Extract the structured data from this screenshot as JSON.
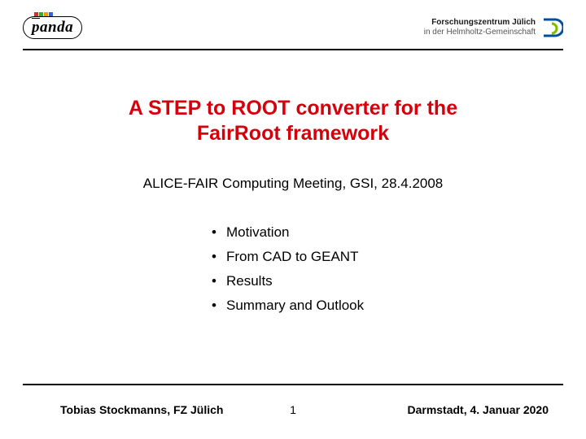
{
  "header": {
    "panda_label": "panda",
    "julich_line1": "Forschungszentrum Jülich",
    "julich_line2": "in der Helmholtz-Gemeinschaft"
  },
  "title_line1": "A STEP to ROOT converter for the",
  "title_line2": "FairRoot framework",
  "subtitle": "ALICE-FAIR Computing Meeting, GSI, 28.4.2008",
  "bullets": [
    "Motivation",
    "From CAD to GEANT",
    "Results",
    "Summary and Outlook"
  ],
  "footer": {
    "author": "Tobias Stockmanns, FZ Jülich",
    "page": "1",
    "date": "Darmstadt, 4. Januar 2020"
  }
}
